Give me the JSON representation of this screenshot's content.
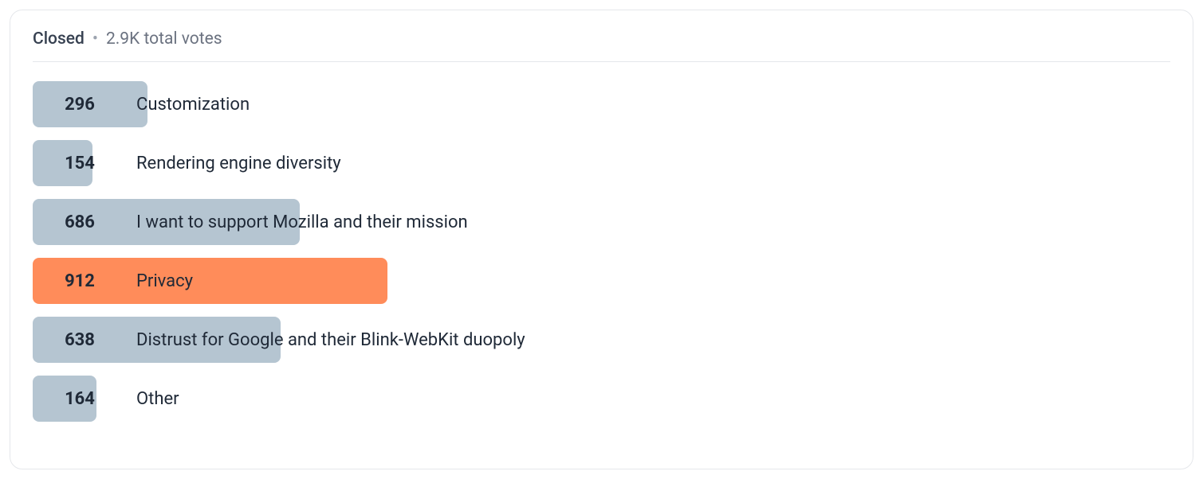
{
  "poll": {
    "status": "Closed",
    "total_votes_label": "2.9K total votes",
    "options": [
      {
        "count": 296,
        "label": "Customization",
        "winner": false
      },
      {
        "count": 154,
        "label": "Rendering engine diversity",
        "winner": false
      },
      {
        "count": 686,
        "label": "I want to support Mozilla and their mission",
        "winner": false
      },
      {
        "count": 912,
        "label": "Privacy",
        "winner": true
      },
      {
        "count": 638,
        "label": "Distrust for Google and their Blink-WebKit duopoly",
        "winner": false
      },
      {
        "count": 164,
        "label": "Other",
        "winner": false
      }
    ]
  },
  "chart_data": {
    "type": "bar",
    "title": "",
    "xlabel": "",
    "ylabel": "",
    "categories": [
      "Customization",
      "Rendering engine diversity",
      "I want to support Mozilla and their mission",
      "Privacy",
      "Distrust for Google and their Blink-WebKit duopoly",
      "Other"
    ],
    "values": [
      296,
      154,
      686,
      912,
      638,
      164
    ],
    "total_votes": 2850,
    "highlight_index": 3,
    "colors": {
      "default": "#b5c5d1",
      "highlight": "#ff8c5a"
    }
  }
}
